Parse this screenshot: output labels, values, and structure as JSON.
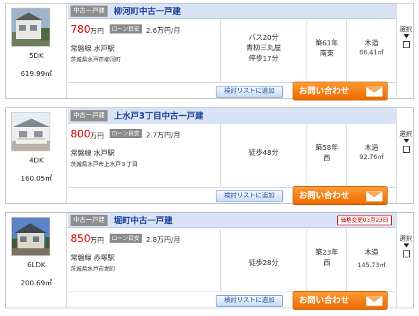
{
  "listings": [
    {
      "category": "中古一戸建",
      "title": "柳河町中古一戸建",
      "price_change": null,
      "layout": "5DK",
      "land_area": "619.99㎡",
      "price": "780",
      "price_unit": "万円",
      "loan_label": "ローン目安",
      "loan_value": "2.6万円/月",
      "line_station": "常磐線 水戸駅",
      "address": "茨城県水戸市柳河町",
      "access": [
        "バス20分",
        "青柳三丸屋",
        "停歩17分"
      ],
      "age": "築61年",
      "direction": "南東",
      "structure": "木造",
      "building_area": "86.41㎡",
      "select_label": "選択",
      "compare_button": "検討リストに追加",
      "inquiry_button": "お問い合わせ"
    },
    {
      "category": "中古一戸建",
      "title": "上水戸3丁目中古一戸建",
      "price_change": null,
      "layout": "4DK",
      "land_area": "160.05㎡",
      "price": "800",
      "price_unit": "万円",
      "loan_label": "ローン目安",
      "loan_value": "2.7万円/月",
      "line_station": "常磐線 水戸駅",
      "address": "茨城県水戸市上水戸３丁目",
      "access": [
        "徒歩48分"
      ],
      "age": "築58年",
      "direction": "西",
      "structure": "木造",
      "building_area": "92.76㎡",
      "select_label": "選択",
      "compare_button": "検討リストに追加",
      "inquiry_button": "お問い合わせ"
    },
    {
      "category": "中古一戸建",
      "title": "堀町中古一戸建",
      "price_change": "価格変更03月23日",
      "layout": "6LDK",
      "land_area": "200.69㎡",
      "price": "850",
      "price_unit": "万円",
      "loan_label": "ローン目安",
      "loan_value": "2.8万円/月",
      "line_station": "常磐線 赤塚駅",
      "address": "茨城県水戸市堀町",
      "access": [
        "徒歩28分"
      ],
      "age": "築23年",
      "direction": "西",
      "structure": "木造",
      "building_area": "145.73㎡",
      "select_label": "選択",
      "compare_button": "検討リストに追加",
      "inquiry_button": "お問い合わせ"
    }
  ],
  "colors": {
    "title_text": "#1e3f9a",
    "title_bar": "#d8e4f6",
    "price_text": "#e00000",
    "inquiry_button": "#f07a10",
    "price_change": "#dd0000"
  }
}
